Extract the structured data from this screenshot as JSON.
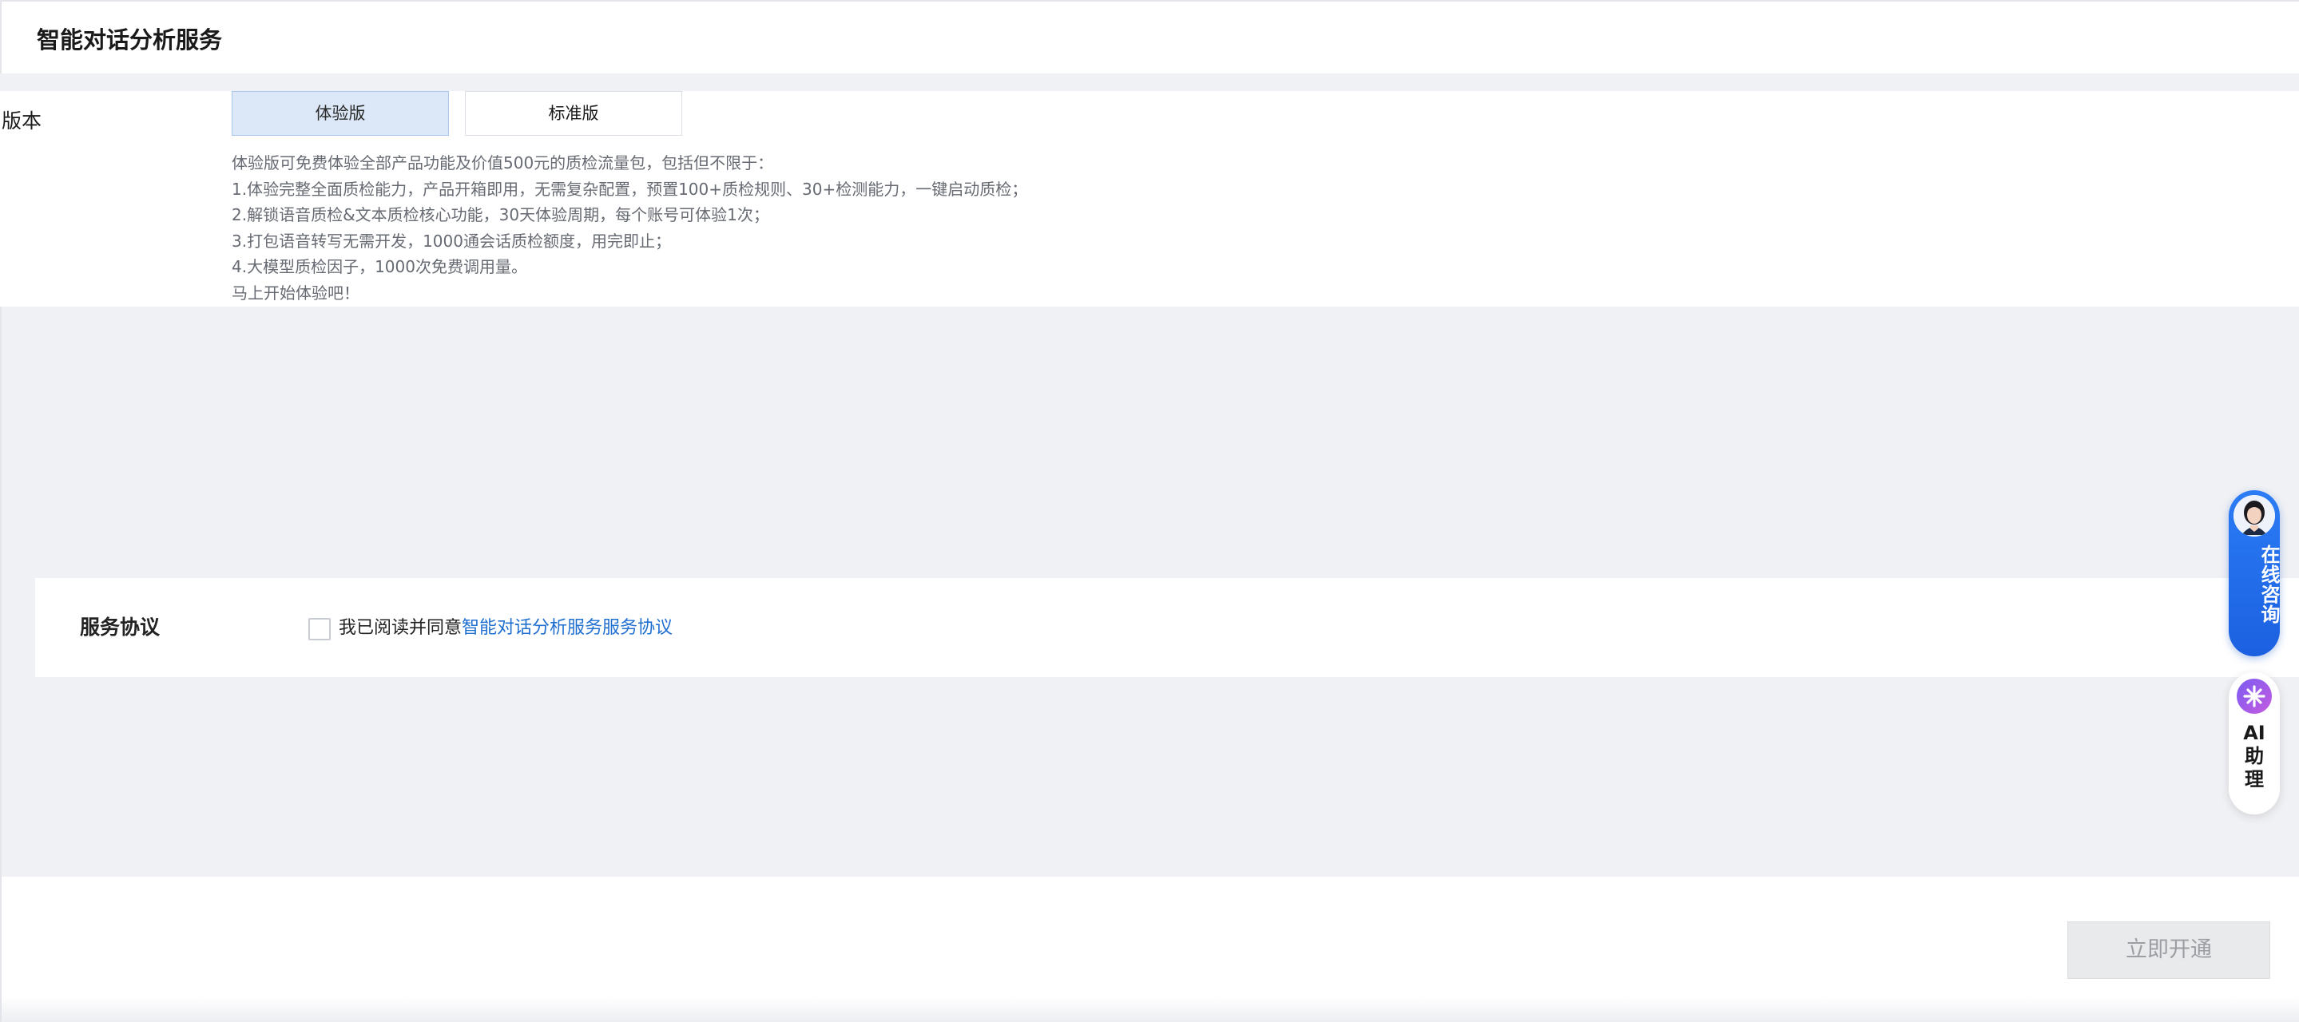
{
  "header": {
    "title": "智能对话分析服务"
  },
  "version": {
    "label": "版本",
    "tabs": [
      {
        "label": "体验版",
        "selected": true
      },
      {
        "label": "标准版",
        "selected": false
      }
    ],
    "description_lines": [
      "体验版可免费体验全部产品功能及价值500元的质检流量包，包括但不限于：",
      "1.体验完整全面质检能力，产品开箱即用，无需复杂配置，预置100+质检规则、30+检测能力，一键启动质检；",
      "2.解锁语音质检&文本质检核心功能，30天体验周期，每个账号可体验1次；",
      "3.打包语音转写无需开发，1000通会话质检额度，用完即止；",
      "4.大模型质检因子，1000次免费调用量。",
      "马上开始体验吧！"
    ]
  },
  "agreement": {
    "label": "服务协议",
    "checked": false,
    "prefix_text": "我已阅读并同意",
    "link_text": "智能对话分析服务服务协议"
  },
  "footer": {
    "submit_label": "立即开通",
    "submit_enabled": false
  },
  "floating": {
    "consult_label": "在线咨询",
    "ai_label_1": "AI",
    "ai_label_2": "助",
    "ai_label_3": "理"
  },
  "colors": {
    "accent_blue": "#1f6fd1",
    "selected_tab_bg": "#dce8f7",
    "consult_bg": "#1b60e0",
    "disabled_button_bg": "#e9eaec"
  }
}
